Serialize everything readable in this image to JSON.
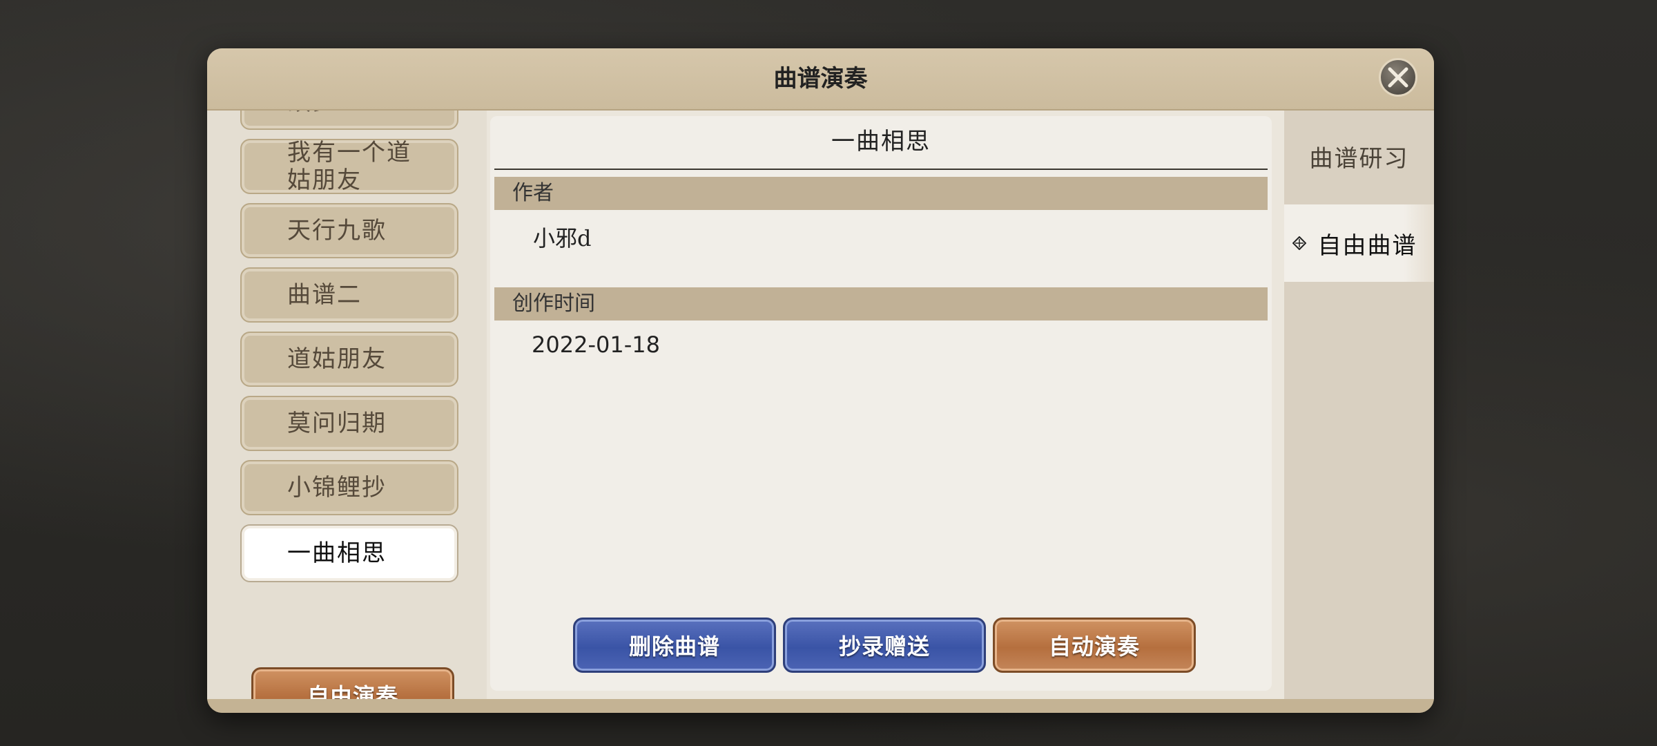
{
  "dialog": {
    "title": "曲谱演奏"
  },
  "song_list": {
    "items": [
      {
        "label": "故乡"
      },
      {
        "label": "我有一个道姑朋友"
      },
      {
        "label": "天行九歌"
      },
      {
        "label": "曲谱二"
      },
      {
        "label": "道姑朋友"
      },
      {
        "label": "莫问归期"
      },
      {
        "label": "小锦鲤抄"
      },
      {
        "label": "一曲相思",
        "selected": true
      }
    ],
    "free_play_label": "自由演奏"
  },
  "detail": {
    "title": "一曲相思",
    "author_header": "作者",
    "author_value": "小邪d",
    "created_header": "创作时间",
    "created_value": "2022-01-18"
  },
  "actions": {
    "delete_label": "删除曲谱",
    "copy_gift_label": "抄录赠送",
    "auto_play_label": "自动演奏"
  },
  "tabs": [
    {
      "label": "曲谱研习",
      "active": false
    },
    {
      "label": "自由曲谱",
      "active": true
    }
  ],
  "colors": {
    "blue_button": "#3a54a6",
    "brown_button": "#b56f3e",
    "selected_item": "#ffffff",
    "header_band": "#c1b196"
  }
}
